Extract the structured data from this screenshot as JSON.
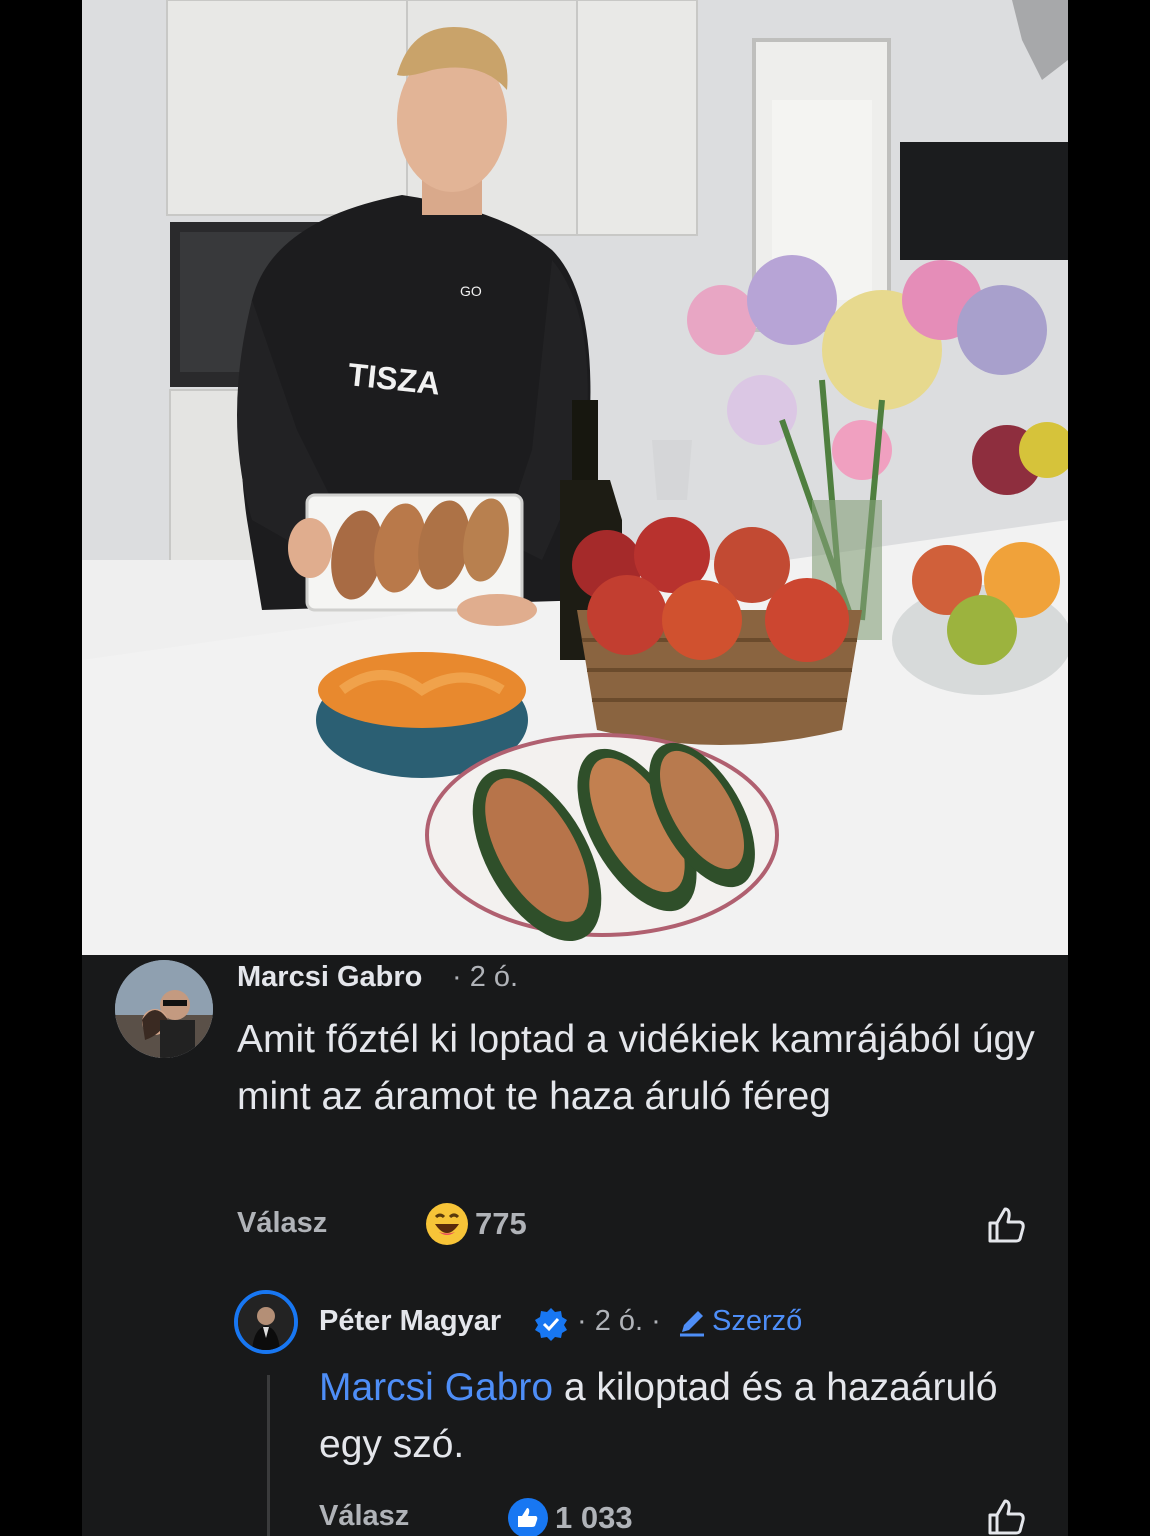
{
  "post": {
    "photo_icon": "cooking-photo",
    "apron_text": "TISZA"
  },
  "comment": {
    "author": "Marcsi Gabro",
    "time": "· 2 ó.",
    "text": "Amit főztél ki loptad a vidékiek kamrájából úgy mint az áramot te haza áruló féreg",
    "reply_label": "Válasz",
    "reaction_icon": "haha-emoji-icon",
    "reaction_count": "775"
  },
  "reply": {
    "author": "Péter Magyar",
    "time": "· 2 ó. ·",
    "badge_label": "Szerző",
    "mention": "Marcsi Gabro",
    "text": " a kiloptad és a hazaáruló egy szó.",
    "reply_label": "Válasz",
    "reaction_icon": "like-reaction-icon",
    "reaction_count": "1 033"
  },
  "colors": {
    "background": "#18191a",
    "mention": "#4e8ef7",
    "verified": "#1877f2"
  }
}
